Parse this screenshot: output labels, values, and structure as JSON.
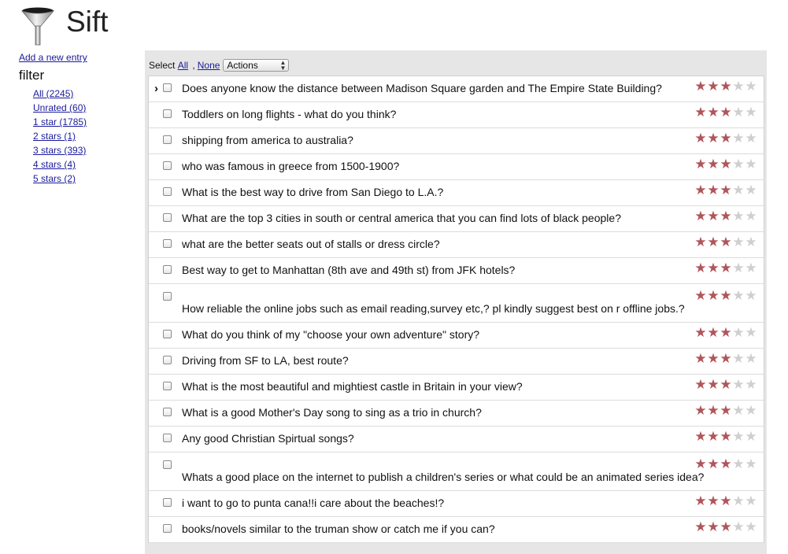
{
  "app": {
    "title": "Sift",
    "logo_icon": "funnel-icon"
  },
  "sidebar": {
    "add_entry": "Add a new entry",
    "filter_heading": "filter",
    "filters": [
      {
        "label": "All (2245)"
      },
      {
        "label": "Unrated (60)"
      },
      {
        "label": "1 star (1785)"
      },
      {
        "label": "2 stars (1)"
      },
      {
        "label": "3 stars (393)"
      },
      {
        "label": "4 stars (4)"
      },
      {
        "label": "5 stars (2)"
      }
    ]
  },
  "toolbar": {
    "select_label": "Select",
    "all_label": "All",
    "separator": ",",
    "none_label": "None",
    "actions_label": "Actions"
  },
  "colors": {
    "star_filled": "#b0555b",
    "star_empty": "#cfcfcf",
    "link": "#1a1a9c",
    "panel_bg": "#e6e6e6"
  },
  "entries": [
    {
      "text": "Does anyone know the distance between Madison Square garden and The Empire State Building?",
      "rating": 3,
      "current": true
    },
    {
      "text": "Toddlers on long flights - what do you think?",
      "rating": 3
    },
    {
      "text": "shipping from america to australia?",
      "rating": 3
    },
    {
      "text": "who was famous in greece from 1500-1900?",
      "rating": 3
    },
    {
      "text": "What is the best way to drive from San Diego to L.A.?",
      "rating": 3
    },
    {
      "text": "What are the top 3 cities in south or central america that you can find lots of black people?",
      "rating": 3
    },
    {
      "text": "what are the better seats out of stalls or dress circle?",
      "rating": 3
    },
    {
      "text": "Best way to get to Manhattan (8th ave and 49th st) from JFK hotels?",
      "rating": 3
    },
    {
      "text": "How reliable the online jobs such as email reading,survey etc,? pl kindly suggest best on r offline jobs.?",
      "rating": 3,
      "wrapped": true
    },
    {
      "text": "What do you think of my \"choose your own adventure\" story?",
      "rating": 3
    },
    {
      "text": "Driving from SF to LA, best route?",
      "rating": 3
    },
    {
      "text": "What is the most beautiful and mightiest castle in Britain in your view?",
      "rating": 3
    },
    {
      "text": "What is a good Mother's Day song to sing as a trio in church?",
      "rating": 3
    },
    {
      "text": "Any good Christian Spirtual songs?",
      "rating": 3
    },
    {
      "text": "Whats a good place on the internet to publish a children's series or what could be an animated series idea?",
      "rating": 3,
      "wrapped": true
    },
    {
      "text": "i want to go to punta cana!!i care about the beaches!?",
      "rating": 3
    },
    {
      "text": "books/novels similar to the truman show or catch me if you can?",
      "rating": 3
    }
  ]
}
